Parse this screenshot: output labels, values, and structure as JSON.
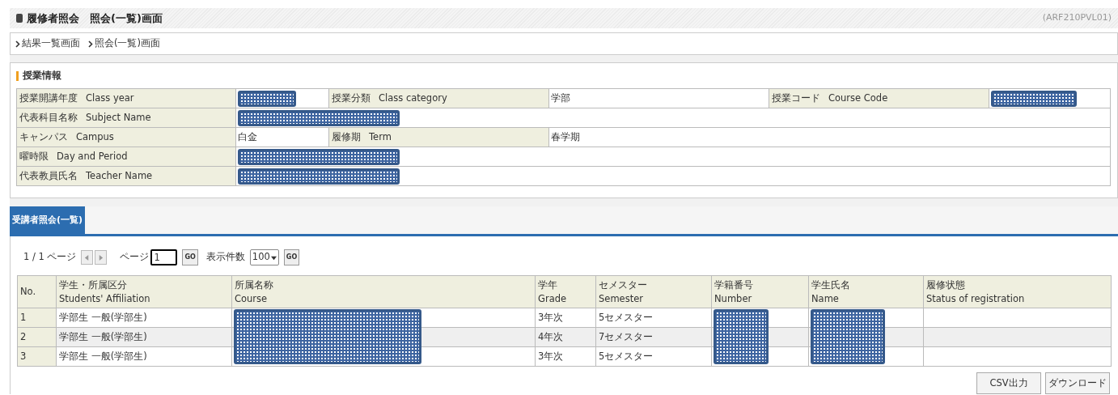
{
  "header": {
    "title": "履修者照会　照会(一覧)画面",
    "screen_id": "(ARF210PVL01)"
  },
  "breadcrumbs": [
    "結果一覧画面",
    "照会(一覧)画面"
  ],
  "course_info": {
    "title": "授業情報",
    "rows": [
      [
        {
          "ja": "授業開講年度",
          "en": "Class year",
          "value": {
            "redacted": true
          }
        },
        {
          "ja": "授業分類",
          "en": "Class category",
          "value": {
            "text": "学部"
          }
        },
        {
          "ja": "授業コード",
          "en": "Course Code",
          "value": {
            "redacted": true
          }
        }
      ],
      [
        {
          "ja": "代表科目名称",
          "en": "Subject Name",
          "value": {
            "redacted": true
          }
        }
      ],
      [
        {
          "ja": "キャンパス",
          "en": "Campus",
          "value": {
            "text": "白金"
          }
        },
        {
          "ja": "履修期",
          "en": "Term",
          "value": {
            "text": "春学期"
          }
        }
      ],
      [
        {
          "ja": "曜時限",
          "en": "Day and Period",
          "value": {
            "redacted": true
          }
        }
      ],
      [
        {
          "ja": "代表教員氏名",
          "en": "Teacher Name",
          "value": {
            "redacted": true
          }
        }
      ]
    ]
  },
  "tabs": [
    {
      "label": "受講者照会(一覧)",
      "selected": true
    }
  ],
  "pager": {
    "status": "1 / 1 ページ",
    "page_label": "ページ",
    "page_value": "1",
    "go": "GO",
    "count_label": "表示件数",
    "count_value": "100",
    "go2": "GO"
  },
  "students": {
    "columns": [
      {
        "ja": "No.",
        "redacted": false
      },
      {
        "ja": "学生・所属区分",
        "en": "Students' Affiliation",
        "redacted": false
      },
      {
        "ja": "所属名称",
        "en": "Course",
        "redacted": true
      },
      {
        "ja": "学年",
        "en": "Grade",
        "redacted": false
      },
      {
        "ja": "セメスター",
        "en": "Semester",
        "redacted": false
      },
      {
        "ja": "学籍番号",
        "en": "Number",
        "redacted": true
      },
      {
        "ja": "学生氏名",
        "en": "Name",
        "redacted": true
      },
      {
        "ja": "履修状態",
        "en": "Status of registration",
        "redacted": false
      }
    ],
    "rows": [
      {
        "no": "1",
        "affiliation": "学部生 一般(学部生)",
        "grade": "3年次",
        "semester": "5セメスター"
      },
      {
        "no": "2",
        "affiliation": "学部生 一般(学部生)",
        "grade": "4年次",
        "semester": "7セメスター"
      },
      {
        "no": "3",
        "affiliation": "学部生 一般(学部生)",
        "grade": "3年次",
        "semester": "5セメスター"
      }
    ]
  },
  "buttons": [
    {
      "label": "CSV出力"
    },
    {
      "label": "ダウンロード"
    }
  ]
}
